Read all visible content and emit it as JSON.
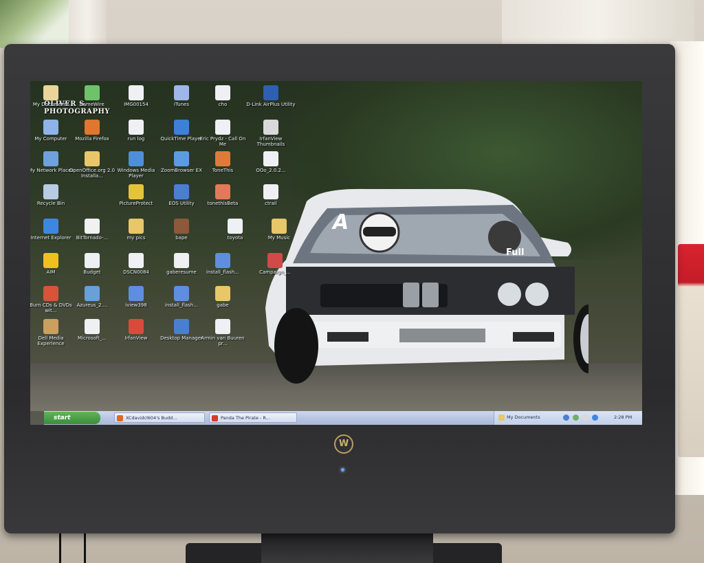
{
  "watermark": {
    "line1": "OLIVER S.",
    "line2": "PHOTOGRAPHY"
  },
  "desktop": {
    "icons": [
      {
        "label": "My Documents",
        "color": "#e9d59a"
      },
      {
        "label": "SameWire",
        "color": "#6fc26a"
      },
      {
        "label": "IMG00154",
        "color": "#eef0f4"
      },
      {
        "label": "iTunes",
        "color": "#9fb6e8"
      },
      {
        "label": "cho",
        "color": "#eef0f4"
      },
      {
        "label": "D-Link AirPlus Utility",
        "color": "#2f5fb0"
      },
      {
        "label": "My Computer",
        "color": "#8fb3e8"
      },
      {
        "label": "Mozilla Firefox",
        "color": "#e0762f"
      },
      {
        "label": "run log",
        "color": "#eef0f4"
      },
      {
        "label": "QuickTime Player",
        "color": "#3e7fd8"
      },
      {
        "label": "Eric Prydz - Call On Me",
        "color": "#eef0f4"
      },
      {
        "label": "IrfanView Thumbnails",
        "color": "#d9d9d9"
      },
      {
        "label": "My Network Places",
        "color": "#6fa2dc"
      },
      {
        "label": "OpenOffice.org 2.0 Installa...",
        "color": "#e8c66a"
      },
      {
        "label": "Windows Media Player",
        "color": "#4f8fd8"
      },
      {
        "label": "ZoomBrowser EX",
        "color": "#5d9be0"
      },
      {
        "label": "ToneThis",
        "color": "#e07a3a"
      },
      {
        "label": "OOo_2.0.2...",
        "color": "#eef0f4"
      },
      {
        "label": "Recycle Bin",
        "color": "#b7cbe2"
      },
      {
        "label": "PictureProtect",
        "color": "#e3c43a"
      },
      {
        "label": "EOS Utility",
        "color": "#4a7fd0"
      },
      {
        "label": "tonethisBeta",
        "color": "#e07a5a"
      },
      {
        "label": "ctrail",
        "color": "#eef0f4"
      },
      {
        "label": "Internet Explorer",
        "color": "#3f86e0"
      },
      {
        "label": "BitTornado-...",
        "color": "#f1f1f1"
      },
      {
        "label": "my pics",
        "color": "#e8c66a"
      },
      {
        "label": "bape",
        "color": "#8a5a3a"
      },
      {
        "label": "toyota",
        "color": "#eef0f4"
      },
      {
        "label": "My Music",
        "color": "#e8c66a"
      },
      {
        "label": "AIM",
        "color": "#f0c020"
      },
      {
        "label": "Budget",
        "color": "#eef0f4"
      },
      {
        "label": "DSCN0084",
        "color": "#eef0f4"
      },
      {
        "label": "gaberesume",
        "color": "#eef0f4"
      },
      {
        "label": "install_flash...",
        "color": "#5f8ee0"
      },
      {
        "label": "Campaign_...",
        "color": "#d04a4a"
      },
      {
        "label": "Burn CDs & DVDs wit...",
        "color": "#d9523a"
      },
      {
        "label": "Azureus_2....",
        "color": "#6aa0d8"
      },
      {
        "label": "iview398",
        "color": "#5f8ee0"
      },
      {
        "label": "install_flash...",
        "color": "#5f8ee0"
      },
      {
        "label": "gabe",
        "color": "#e8c66a"
      },
      {
        "label": "Dell Media Experience",
        "color": "#c9a060"
      },
      {
        "label": "Microsoft_...",
        "color": "#eef0f4"
      },
      {
        "label": "IrfanView",
        "color": "#d94a3a"
      },
      {
        "label": "Desktop Manager",
        "color": "#4a7fd0"
      },
      {
        "label": "Armin van Buuren pr...",
        "color": "#eef0f4"
      }
    ]
  },
  "taskbar": {
    "start_label": "start",
    "tasks": [
      {
        "label": "XCdavidcl604's Budd...",
        "color": "#d96a2a"
      },
      {
        "label": "Panda The Pirate - R...",
        "color": "#d93a2a"
      }
    ],
    "tray_label": "My Documents",
    "clock": "2:28 PM"
  },
  "monitor": {
    "logo_glyph": "W"
  },
  "car": {
    "windshield_text": "A",
    "banner_text": "Full"
  }
}
